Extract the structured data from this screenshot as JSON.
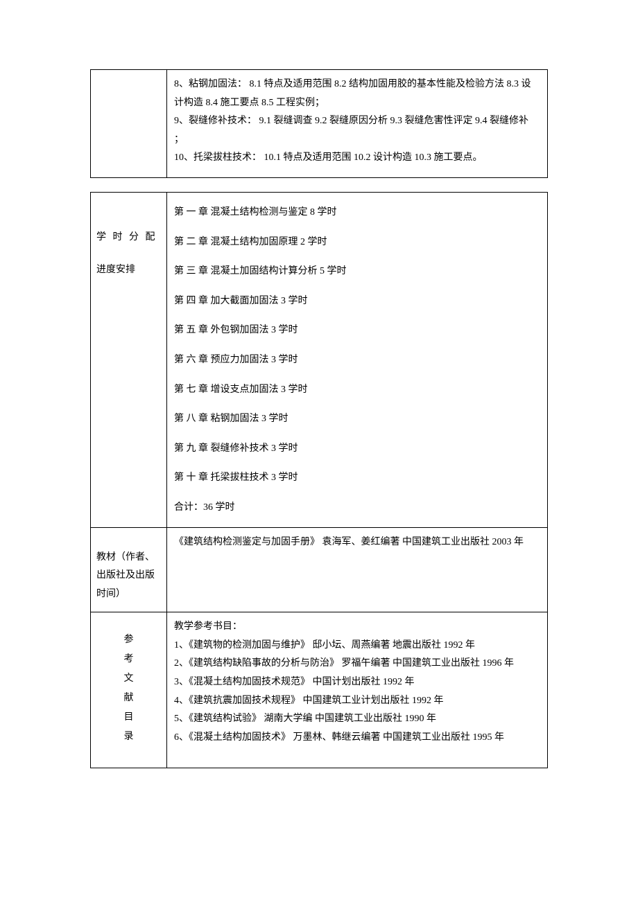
{
  "table1": {
    "content": {
      "line1": "8、粘钢加固法：  8.1 特点及适用范围  8.2 结构加固用胶的基本性能及检验方法  8.3 设计构造  8.4 施工要点  8.5 工程实例；",
      "line2": "9、裂缝修补技术：  9.1 裂缝调查  9.2 裂缝原因分析  9.3 裂缝危害性评定  9.4 裂缝修补 ；",
      "line3": "10、托梁拔柱技术：  10.1 特点及适用范围  10.2 设计构造  10.3 施工要点。"
    }
  },
  "table2": {
    "schedule": {
      "label1": "学 时 分 配",
      "label2": "进度安排",
      "chapters": [
        "第  一  章  混凝土结构检测与鉴定  8 学时",
        "第  二  章  混凝土结构加固原理  2 学时",
        "第  三  章  混凝土加固结构计算分析  5 学时",
        "第  四  章  加大截面加固法  3 学时",
        "第  五  章  外包钢加固法  3 学时",
        "第  六  章  预应力加固法  3 学时",
        "第  七  章  增设支点加固法  3 学时",
        "第  八  章  粘钢加固法  3 学时",
        "第  九  章  裂缝修补技术  3 学时",
        "第  十  章  托梁拔柱技术  3 学时"
      ],
      "total": "合计：36 学时"
    },
    "textbook": {
      "label": "教材（作者、出版社及出版时间）",
      "content": "《建筑结构检测鉴定与加固手册》  袁海军、姜红编著  中国建筑工业出版社  2003 年"
    },
    "references": {
      "label1": "参",
      "label2": "考",
      "label3": "文",
      "label4": "献",
      "label5": "目",
      "label6": "录",
      "header": "教学参考书目：",
      "items": [
        "1、《建筑物的检测加固与维护》  邸小坛、周燕编著  地震出版社  1992 年",
        "2、《建筑结构缺陷事故的分析与防治》  罗福午编著  中国建筑工业出版社  1996 年",
        "3、《混凝土结构加固技术规范》  中国计划出版社  1992 年",
        "4、《建筑抗震加固技术规程》  中国建筑工业计划出版社  1992 年",
        "5、《建筑结构试验》  湖南大学编  中国建筑工业出版社  1990 年",
        "6、《混凝土结构加固技术》  万墨林、韩继云编著  中国建筑工业出版社  1995 年"
      ]
    }
  }
}
